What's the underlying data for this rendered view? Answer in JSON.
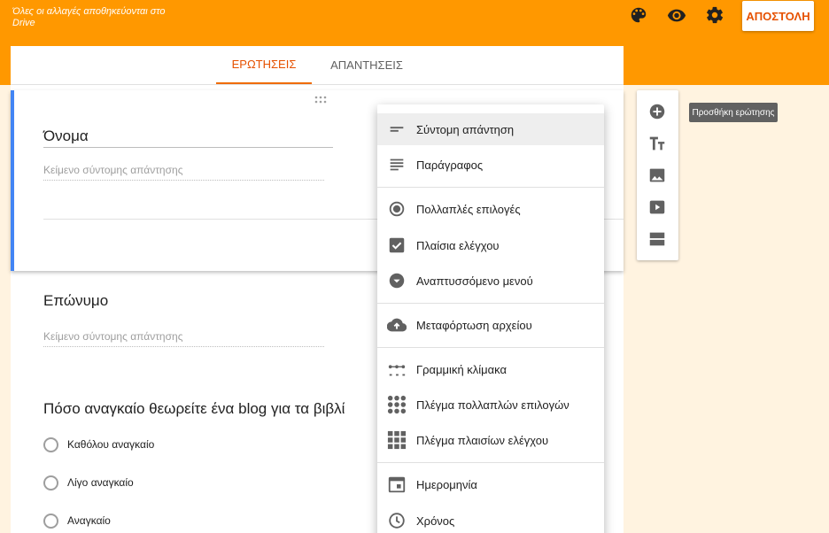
{
  "header": {
    "saved_status": "Όλες οι αλλαγές αποθηκεύονται στο Drive",
    "icons": [
      "palette-icon",
      "eye-icon",
      "gear-icon"
    ],
    "send_label": "ΑΠΟΣΤΟΛΗ",
    "color": "#ff9800"
  },
  "tabs": [
    {
      "label": "ΕΡΩΤΗΣΕΙΣ",
      "active": true
    },
    {
      "label": "ΑΠΑΝΤΗΣΕΙΣ",
      "active": false
    }
  ],
  "questions": [
    {
      "title": "Όνομα",
      "hint": "Κείμενο σύντομης απάντησης"
    },
    {
      "title": "Επώνυμο",
      "hint": "Κείμενο σύντομης απάντησης"
    },
    {
      "title": "Πόσο αναγκαίο θεωρείτε ένα blog για τα βιβλί",
      "options": [
        "Καθόλου αναγκαίο",
        "Λίγο αναγκαίο",
        "Αναγκαίο"
      ]
    }
  ],
  "toolbar": {
    "icons": [
      "add-circle-icon",
      "title-text-icon",
      "image-icon",
      "video-icon",
      "section-icon"
    ],
    "tooltip": "Προσθήκη ερώτησης"
  },
  "menu": {
    "items": [
      {
        "label": "Σύντομη απάντηση",
        "icon": "short-answer-icon",
        "highlighted": true
      },
      {
        "label": "Παράγραφος",
        "icon": "paragraph-icon"
      },
      {
        "label": "Πολλαπλές επιλογές",
        "icon": "radio-button-icon"
      },
      {
        "label": "Πλαίσια ελέγχου",
        "icon": "checkbox-icon"
      },
      {
        "label": "Αναπτυσσόμενο μενού",
        "icon": "dropdown-arrow-icon"
      },
      {
        "label": "Μεταφόρτωση αρχείου",
        "icon": "cloud-upload-icon"
      },
      {
        "label": "Γραμμική κλίμακα",
        "icon": "linear-scale-icon"
      },
      {
        "label": "Πλέγμα πολλαπλών επιλογών",
        "icon": "radio-grid-icon"
      },
      {
        "label": "Πλέγμα πλαισίων ελέγχου",
        "icon": "checkbox-grid-icon"
      },
      {
        "label": "Ημερομηνία",
        "icon": "calendar-icon"
      },
      {
        "label": "Χρόνος",
        "icon": "clock-icon"
      }
    ]
  }
}
